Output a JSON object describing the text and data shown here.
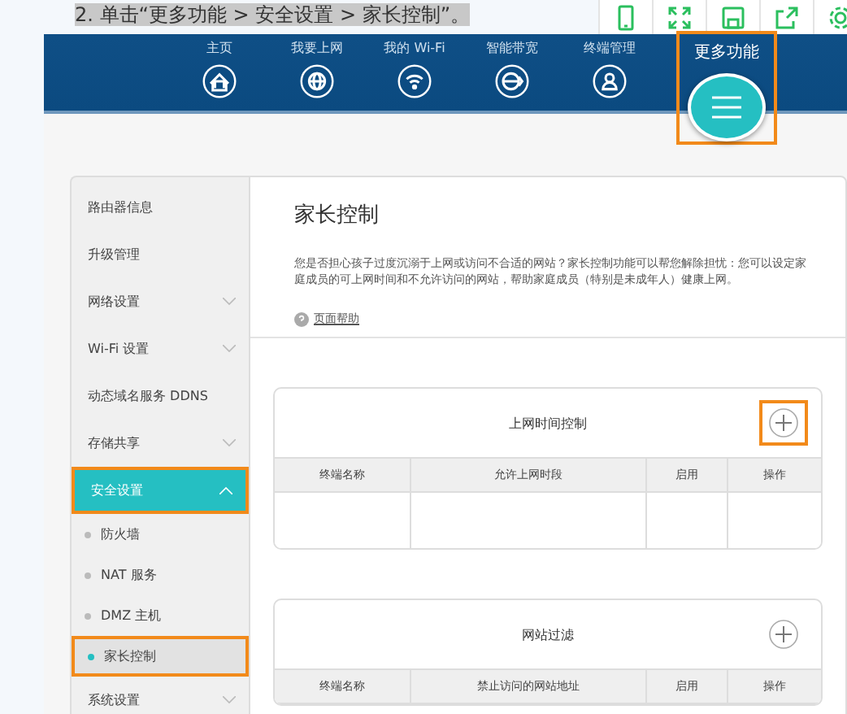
{
  "caption": "2. 单击“更多功能 > 安全设置 > 家长控制”。",
  "toolbar": [
    {
      "kind": "phone"
    },
    {
      "kind": "expand"
    },
    {
      "kind": "save"
    },
    {
      "kind": "share"
    },
    {
      "kind": "gear"
    }
  ],
  "nav": [
    {
      "label": "主页",
      "kind": "home",
      "highlighted": false
    },
    {
      "label": "我要上网",
      "kind": "globe",
      "highlighted": false
    },
    {
      "label": "我的 Wi-Fi",
      "kind": "wifi",
      "highlighted": false
    },
    {
      "label": "智能带宽",
      "kind": "speed",
      "highlighted": false
    },
    {
      "label": "终端管理",
      "kind": "user",
      "highlighted": false
    },
    {
      "label": "更多功能",
      "kind": "menu",
      "highlighted": true
    }
  ],
  "sidebar": [
    {
      "label": "路由器信息",
      "kind": "item",
      "selected": false,
      "highlighted": false
    },
    {
      "label": "升级管理",
      "kind": "item",
      "selected": false,
      "highlighted": false
    },
    {
      "label": "网络设置",
      "kind": "group",
      "expanded": false,
      "selected": false,
      "highlighted": false
    },
    {
      "label": "Wi-Fi 设置",
      "kind": "group",
      "expanded": false,
      "selected": false,
      "highlighted": false
    },
    {
      "label": "动态域名服务 DDNS",
      "kind": "item",
      "selected": false,
      "highlighted": false
    },
    {
      "label": "存储共享",
      "kind": "group",
      "expanded": false,
      "selected": false,
      "highlighted": false
    },
    {
      "label": "安全设置",
      "kind": "group",
      "expanded": true,
      "selected": true,
      "highlighted": true
    },
    {
      "label": "防火墙",
      "kind": "sub",
      "selected": false,
      "highlighted": false
    },
    {
      "label": "NAT 服务",
      "kind": "sub",
      "selected": false,
      "highlighted": false
    },
    {
      "label": "DMZ 主机",
      "kind": "sub",
      "selected": false,
      "highlighted": false
    },
    {
      "label": "家长控制",
      "kind": "sub",
      "selected": true,
      "highlighted": true
    },
    {
      "label": "系统设置",
      "kind": "group",
      "expanded": false,
      "selected": false,
      "highlighted": false
    }
  ],
  "page": {
    "title": "家长控制",
    "description": "您是否担心孩子过度沉溺于上网或访问不合适的网站？家长控制功能可以帮您解除担忧：您可以设定家庭成员的可上网时间和不允许访问的网站，帮助家庭成员（特别是未成年人）健康上网。",
    "help_link": "页面帮助"
  },
  "cards": [
    {
      "title": "上网时间控制",
      "add_highlighted": true,
      "columns": [
        "终端名称",
        "允许上网时段",
        "启用",
        "操作"
      ],
      "empty_row": true
    },
    {
      "title": "网站过滤",
      "add_highlighted": false,
      "columns": [
        "终端名称",
        "禁止访问的网站地址",
        "启用",
        "操作"
      ],
      "empty_row": false
    }
  ]
}
